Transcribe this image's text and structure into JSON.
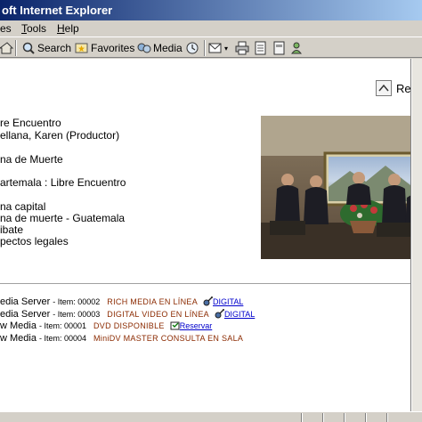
{
  "window": {
    "title": "oft Internet Explorer"
  },
  "menu": {
    "items": [
      "es",
      "Tools",
      "Help"
    ]
  },
  "toolbar": {
    "search_label": "Search",
    "favorites_label": "Favorites",
    "media_label": "Media"
  },
  "nav": {
    "regresar_label": "Regr"
  },
  "record": {
    "lines": [
      "re Encuentro",
      "ellana, Karen (Productor)",
      "",
      "na de Muerte",
      "",
      "artemala : Libre Encuentro",
      "",
      "na capital",
      "na de muerte - Guatemala",
      "ibate",
      "pectos legales"
    ]
  },
  "holdings": [
    {
      "server": "edia Server",
      "item": "- Item: 00002",
      "type": "RICH MEDIA  EN LÍNEA",
      "link": "DIGITAL",
      "icon": "satellite-icon"
    },
    {
      "server": "edia Server",
      "item": "- Item: 00003",
      "type": "DIGITAL VIDEO  EN LÍNEA",
      "link": "DIGITAL",
      "icon": "satellite-icon"
    },
    {
      "server": "w Media",
      "item": "- Item: 00001",
      "type": "DVD  DISPONIBLE",
      "link": "Reservar",
      "icon": "reserve-icon"
    },
    {
      "server": "w Media",
      "item": "- Item: 00004",
      "type": "MiniDV MASTER  CONSULTA EN SALA",
      "link": "",
      "icon": ""
    }
  ],
  "colors": {
    "titlebar_start": "#0a246a",
    "titlebar_end": "#a6caf0",
    "holding_type": "#8b2a00",
    "link": "#0000cc"
  }
}
